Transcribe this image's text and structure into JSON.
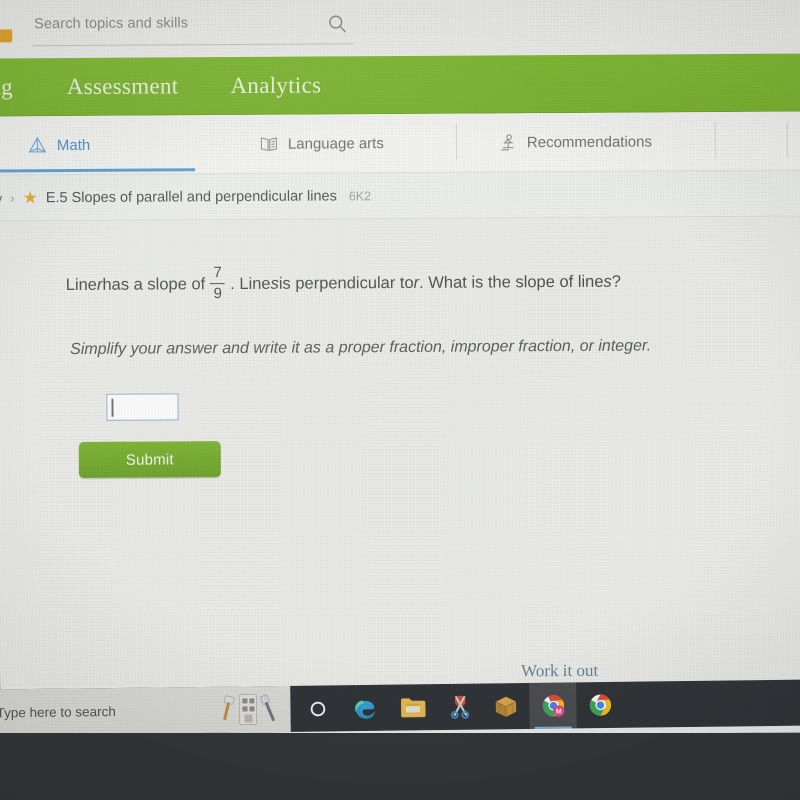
{
  "search": {
    "placeholder": "Search topics and skills",
    "icon": "search-icon"
  },
  "green_nav": {
    "items": [
      {
        "label": "ing",
        "name": "nav-learning-truncated"
      },
      {
        "label": "Assessment",
        "name": "nav-assessment"
      },
      {
        "label": "Analytics",
        "name": "nav-analytics"
      }
    ],
    "color": "#7cb92b"
  },
  "subject_tabs": {
    "items": [
      {
        "label": "Math",
        "icon": "pyramid-icon",
        "active": true
      },
      {
        "label": "Language arts",
        "icon": "open-book-icon",
        "active": false
      },
      {
        "label": "Recommendations",
        "icon": "recommendations-icon",
        "active": false
      }
    ],
    "active_underline_color": "#55a0d2"
  },
  "breadcrumb": {
    "truncated_parent": "y",
    "separator": "›",
    "star_icon": "★",
    "skill_title": "E.5 Slopes of parallel and perpendicular lines",
    "skill_code": "6K2"
  },
  "question": {
    "part1": "Line ",
    "var_r1": "r",
    "part2": " has a slope of ",
    "numerator": "7",
    "denominator": "9",
    "part3": ". Line ",
    "var_s1": "s",
    "part4": " is perpendicular to ",
    "var_r2": "r",
    "part5": ". What is the slope of line ",
    "var_s2": "s",
    "part6": "?"
  },
  "instructions": "Simplify your answer and write it as a proper fraction, improper fraction, or integer.",
  "answer": {
    "value": "",
    "placeholder": ""
  },
  "submit": {
    "label": "Submit",
    "color": "#74ad29"
  },
  "work_it_out": {
    "label": "Work it out",
    "color": "#5d8296"
  },
  "taskbar": {
    "search_placeholder": "Type here to search",
    "icons": [
      {
        "name": "cortana-icon",
        "label": "Cortana"
      },
      {
        "name": "edge-icon",
        "label": "Microsoft Edge"
      },
      {
        "name": "file-explorer-icon",
        "label": "File Explorer"
      },
      {
        "name": "snipping-tool-icon",
        "label": "Snipping Tool"
      },
      {
        "name": "crate-icon",
        "label": "Minecraft"
      },
      {
        "name": "chrome-profile-icon",
        "label": "Chrome",
        "badge": "M",
        "active": true
      },
      {
        "name": "chrome-icon",
        "label": "Chrome",
        "active": false
      }
    ]
  }
}
